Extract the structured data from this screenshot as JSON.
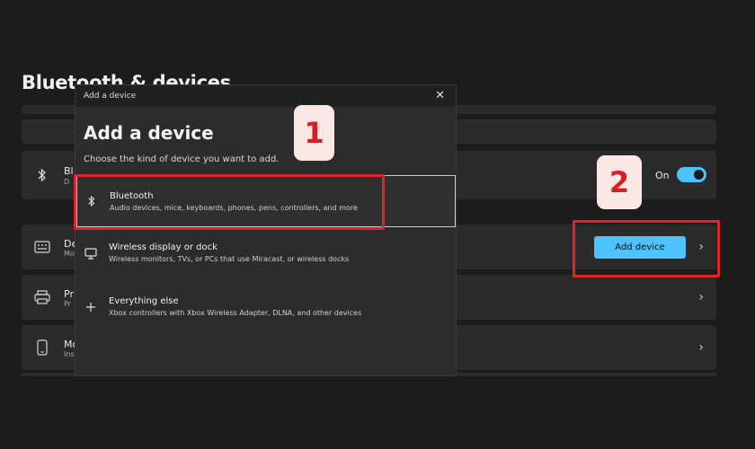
{
  "settings": {
    "page_title": "Bluetooth & devices",
    "rows": {
      "bluetooth": {
        "title": "Bl",
        "sub": "D"
      },
      "devices": {
        "title": "De",
        "sub": "Mo"
      },
      "printers": {
        "title": "Pri",
        "sub": "Pr"
      },
      "mobile": {
        "title": "Mo",
        "sub": "Ins"
      }
    },
    "toggle_label": "On",
    "add_device_label": "Add device"
  },
  "dialog": {
    "window_title": "Add a device",
    "heading": "Add a device",
    "description": "Choose the kind of device you want to add.",
    "options": [
      {
        "title": "Bluetooth",
        "subtitle": "Audio devices, mice, keyboards, phones, pens, controllers, and more",
        "icon": "bluetooth-icon"
      },
      {
        "title": "Wireless display or dock",
        "subtitle": "Wireless monitors, TVs, or PCs that use Miracast, or wireless docks",
        "icon": "monitor-icon"
      },
      {
        "title": "Everything else",
        "subtitle": "Xbox controllers with Xbox Wireless Adapter, DLNA, and other devices",
        "icon": "plus-icon"
      }
    ]
  },
  "annotations": {
    "step1": "1",
    "step2": "2",
    "highlight_color": "#e0242c"
  },
  "colors": {
    "accent": "#4cc2ff",
    "background": "#1c1c1c",
    "card": "#2b2b2b"
  }
}
